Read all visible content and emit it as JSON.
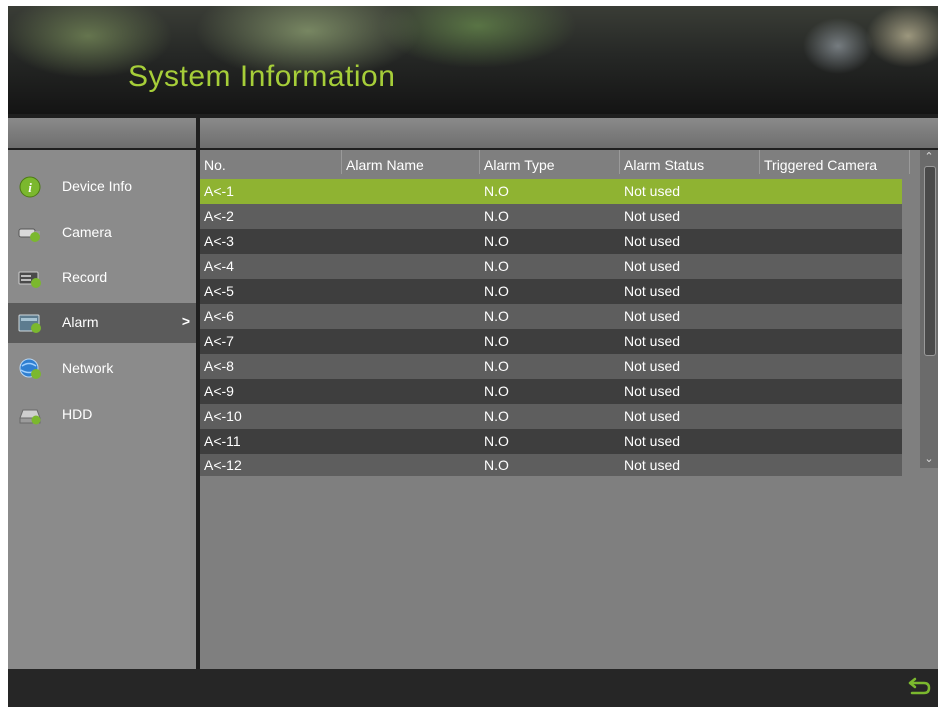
{
  "header": {
    "title": "System Information"
  },
  "sidebar": {
    "items": [
      {
        "label": "Device Info",
        "icon": "info-icon"
      },
      {
        "label": "Camera",
        "icon": "camera-icon"
      },
      {
        "label": "Record",
        "icon": "record-icon"
      },
      {
        "label": "Alarm",
        "icon": "alarm-icon",
        "active": true,
        "chevron": ">"
      },
      {
        "label": "Network",
        "icon": "network-icon"
      },
      {
        "label": "HDD",
        "icon": "hdd-icon"
      }
    ]
  },
  "table": {
    "columns": [
      "No.",
      "Alarm Name",
      "Alarm Type",
      "Alarm Status",
      "Triggered Camera"
    ],
    "rows": [
      {
        "no": "A<-1",
        "name": "",
        "type": "N.O",
        "status": "Not used",
        "camera": ""
      },
      {
        "no": "A<-2",
        "name": "",
        "type": "N.O",
        "status": "Not used",
        "camera": ""
      },
      {
        "no": "A<-3",
        "name": "",
        "type": "N.O",
        "status": "Not used",
        "camera": ""
      },
      {
        "no": "A<-4",
        "name": "",
        "type": "N.O",
        "status": "Not used",
        "camera": ""
      },
      {
        "no": "A<-5",
        "name": "",
        "type": "N.O",
        "status": "Not used",
        "camera": ""
      },
      {
        "no": "A<-6",
        "name": "",
        "type": "N.O",
        "status": "Not used",
        "camera": ""
      },
      {
        "no": "A<-7",
        "name": "",
        "type": "N.O",
        "status": "Not used",
        "camera": ""
      },
      {
        "no": "A<-8",
        "name": "",
        "type": "N.O",
        "status": "Not used",
        "camera": ""
      },
      {
        "no": "A<-9",
        "name": "",
        "type": "N.O",
        "status": "Not used",
        "camera": ""
      },
      {
        "no": "A<-10",
        "name": "",
        "type": "N.O",
        "status": "Not used",
        "camera": ""
      },
      {
        "no": "A<-11",
        "name": "",
        "type": "N.O",
        "status": "Not used",
        "camera": ""
      },
      {
        "no": "A<-12",
        "name": "",
        "type": "N.O",
        "status": "Not used",
        "camera": ""
      }
    ],
    "selected_row": 0
  },
  "footer": {
    "back_icon": "back-icon"
  },
  "colors": {
    "accent": "#a6ce39",
    "selected_row": "#8fb332"
  }
}
